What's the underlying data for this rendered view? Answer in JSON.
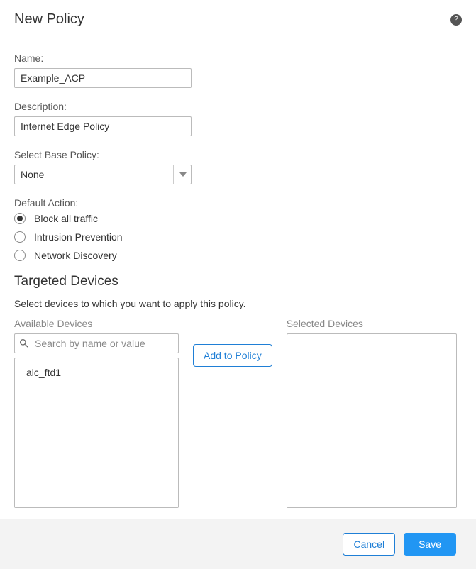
{
  "header": {
    "title": "New Policy"
  },
  "fields": {
    "name": {
      "label": "Name:",
      "value": "Example_ACP"
    },
    "description": {
      "label": "Description:",
      "value": "Internet Edge Policy"
    },
    "basePolicy": {
      "label": "Select Base Policy:",
      "value": "None"
    },
    "defaultAction": {
      "label": "Default Action:",
      "options": [
        {
          "label": "Block all traffic",
          "selected": true
        },
        {
          "label": "Intrusion Prevention",
          "selected": false
        },
        {
          "label": "Network Discovery",
          "selected": false
        }
      ]
    }
  },
  "targetedDevices": {
    "heading": "Targeted Devices",
    "subtext": "Select devices to which you want to apply this policy.",
    "available": {
      "label": "Available Devices",
      "searchPlaceholder": "Search by name or value",
      "items": [
        "alc_ftd1"
      ]
    },
    "addButton": "Add to Policy",
    "selected": {
      "label": "Selected Devices",
      "items": []
    }
  },
  "footer": {
    "cancel": "Cancel",
    "save": "Save"
  }
}
